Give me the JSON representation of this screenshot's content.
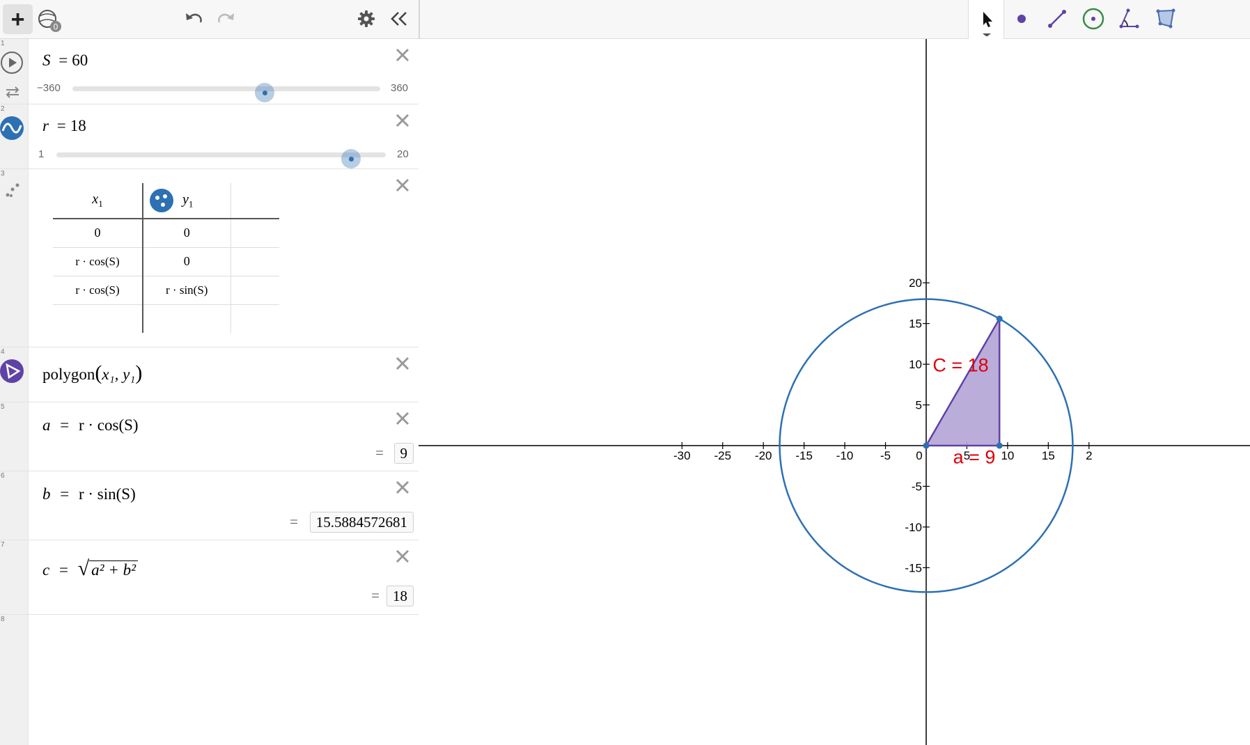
{
  "toolbar": {
    "add_label": "+",
    "folder_badge": "0",
    "collapse_label": "«"
  },
  "expressions": [
    {
      "num": "1",
      "var": "S",
      "eq": "=",
      "value": "60",
      "slider": {
        "min": "−360",
        "max": "360",
        "fraction": 0.625
      }
    },
    {
      "num": "2",
      "var": "r",
      "eq": "=",
      "value": "18",
      "slider": {
        "min": "1",
        "max": "20",
        "fraction": 0.895
      }
    },
    {
      "num": "3",
      "table": {
        "headers": [
          "x",
          "y"
        ],
        "header_subs": [
          "1",
          "1"
        ],
        "rows": [
          [
            "0",
            "0"
          ],
          [
            "r · cos(S)",
            "0"
          ],
          [
            "r · cos(S)",
            "r · sin(S)"
          ]
        ]
      }
    },
    {
      "num": "4",
      "func": "polygon",
      "args": "x₁, y₁"
    },
    {
      "num": "5",
      "lhs": "a",
      "eq": "=",
      "rhs": "r · cos(S)",
      "result": "9"
    },
    {
      "num": "6",
      "lhs": "b",
      "eq": "=",
      "rhs": "r · sin(S)",
      "result": "15.5884572681"
    },
    {
      "num": "7",
      "lhs": "c",
      "eq": "=",
      "rhs_prefix": "√",
      "rhs": "a² + b²",
      "result": "18"
    },
    {
      "num": "8"
    }
  ],
  "result_eq": "=",
  "graph": {
    "x_ticks": [
      "-30",
      "-25",
      "-20",
      "-15",
      "-10",
      "-5",
      "0",
      "5",
      "10",
      "15",
      "2"
    ],
    "y_ticks": [
      "20",
      "15",
      "10",
      "5",
      "-5",
      "-10",
      "-15"
    ],
    "label_hyp": "C = 18",
    "label_base": "a = 9",
    "circle_radius": 18,
    "triangle": [
      [
        0,
        0
      ],
      [
        9,
        0
      ],
      [
        9,
        15.5884572681
      ]
    ],
    "colors": {
      "circle": "#2d70b3",
      "triangle_fill": "#b3a4d6",
      "triangle_stroke": "#6042a6",
      "label": "#e0000a"
    }
  }
}
